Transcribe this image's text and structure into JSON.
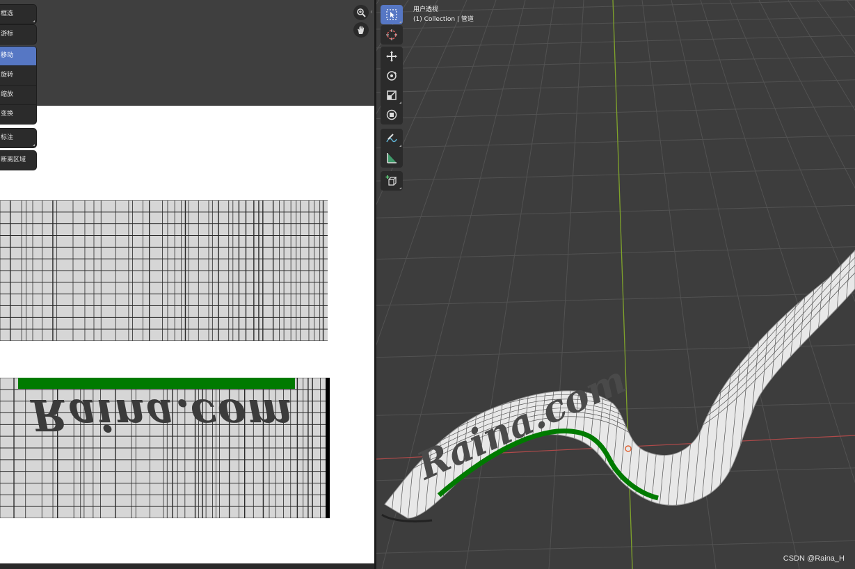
{
  "uv_editor": {
    "toolbar_groups": [
      [
        {
          "label": "框选",
          "has_submenu": true
        }
      ],
      [
        {
          "label": "游标",
          "has_submenu": false
        }
      ],
      [
        {
          "label": "移动",
          "active": true
        },
        {
          "label": "旋转"
        },
        {
          "label": "缩放"
        },
        {
          "label": "变换"
        }
      ],
      [
        {
          "label": "标注",
          "has_submenu": true
        }
      ],
      [
        {
          "label": "断离区域",
          "has_submenu": false
        }
      ]
    ],
    "nav_icons": [
      "zoom-icon",
      "hand-pan-icon"
    ],
    "texture_text": "Raina.com",
    "texture_seam_color": "#007a00"
  },
  "viewport": {
    "view_name": "用户透视",
    "collection_info": "(1) Collection | 管道",
    "tools": [
      {
        "name": "select-box-icon",
        "active": true,
        "has_submenu": true
      },
      {
        "name": "cursor-icon"
      },
      {
        "name": "move-icon"
      },
      {
        "name": "rotate-icon"
      },
      {
        "name": "scale-icon",
        "has_submenu": true
      },
      {
        "name": "transform-icon"
      },
      {
        "name": "annotate-icon",
        "has_submenu": true
      },
      {
        "name": "measure-icon"
      },
      {
        "name": "add-cube-icon",
        "has_submenu": true
      }
    ],
    "mesh_text": "Raina.com",
    "accent_color": "#5677c4",
    "y_axis_color": "#7fa32a",
    "x_axis_color": "#b04a4a"
  },
  "watermark": "CSDN @Raina_H"
}
